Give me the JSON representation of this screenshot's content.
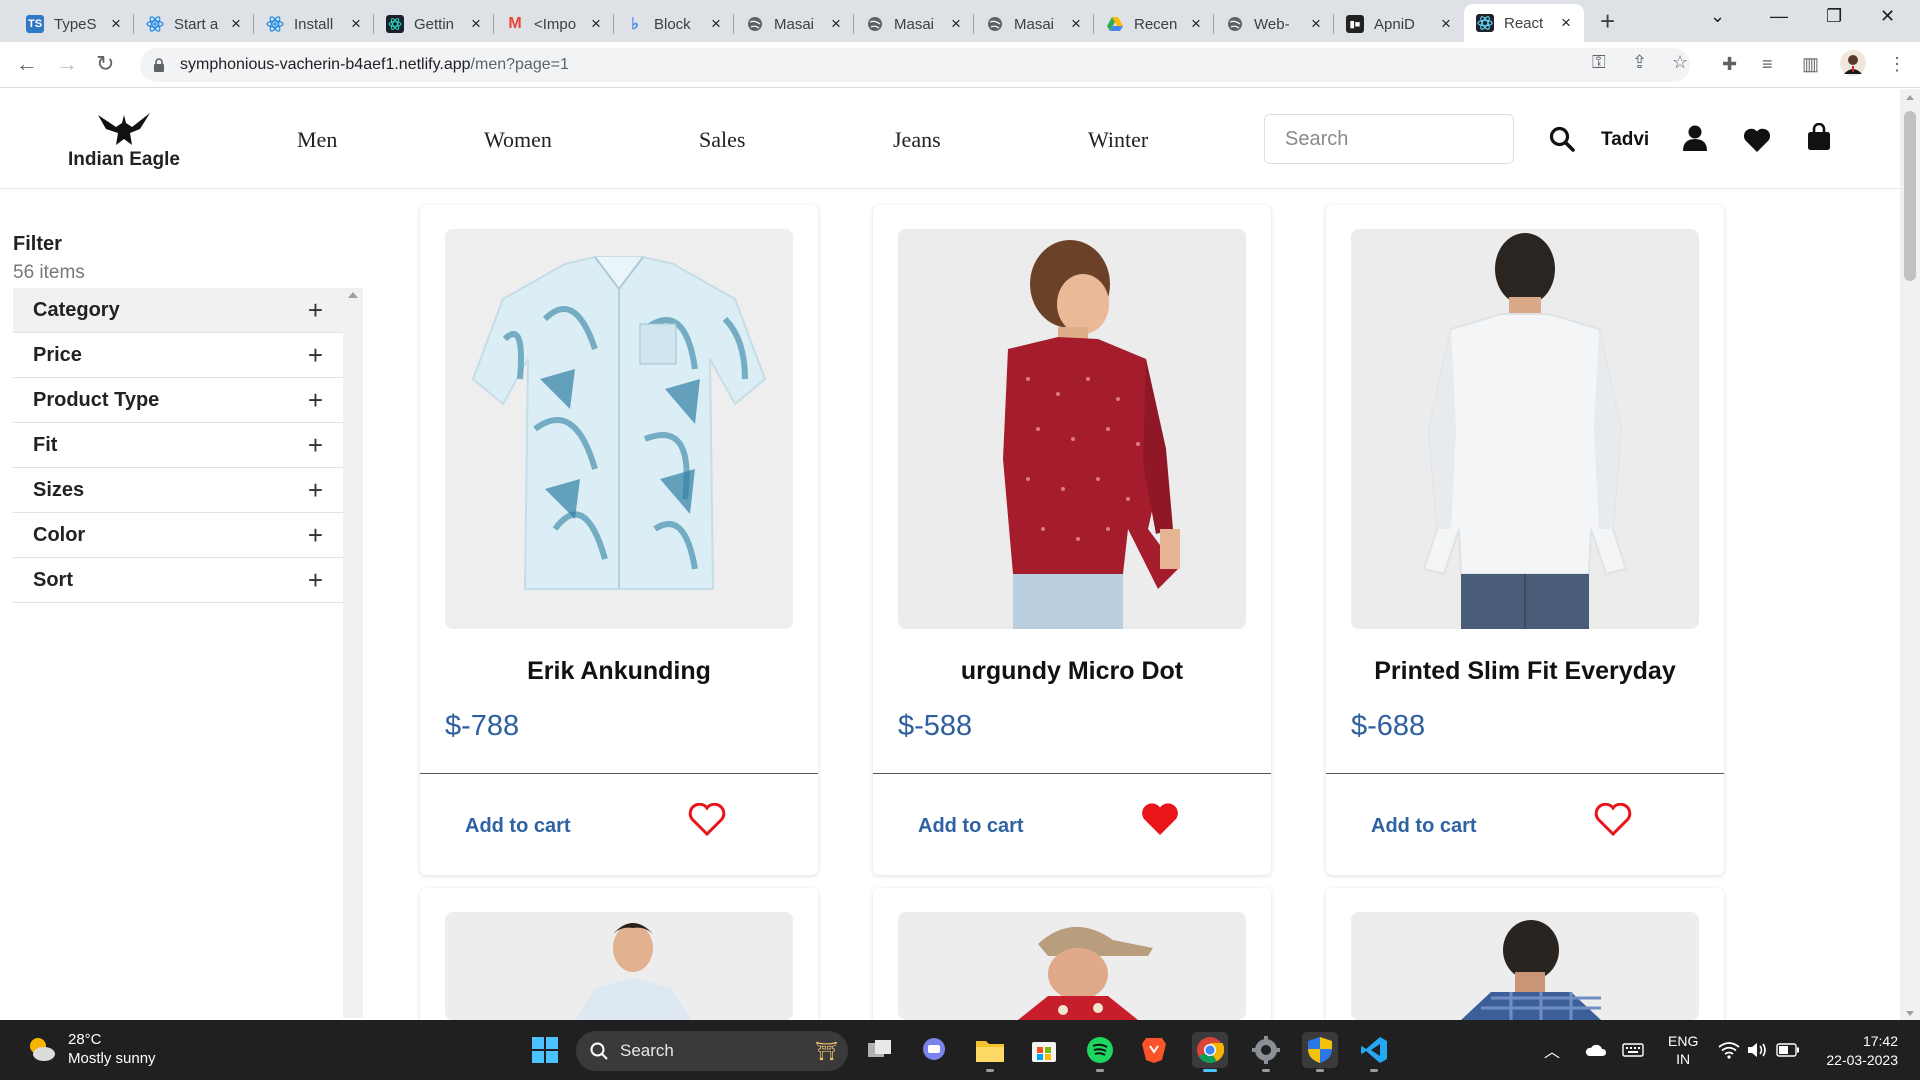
{
  "browser": {
    "tabs": [
      {
        "label": "TypeS",
        "icon": "typescript-icon",
        "color": "#3178c6"
      },
      {
        "label": "Start a",
        "icon": "react-icon",
        "color": "#1e88e5"
      },
      {
        "label": "Install",
        "icon": "react-icon",
        "color": "#1e88e5"
      },
      {
        "label": "Gettin",
        "icon": "chakra-icon",
        "color": "#2dd4bf"
      },
      {
        "label": "<Impo",
        "icon": "gmail-icon",
        "color": "#ea4335"
      },
      {
        "label": "Block",
        "icon": "block-icon",
        "color": "#4285f4"
      },
      {
        "label": "Masai",
        "icon": "globe-icon",
        "color": "#5f6368"
      },
      {
        "label": "Masai",
        "icon": "globe-icon",
        "color": "#5f6368"
      },
      {
        "label": "Masai",
        "icon": "globe-icon",
        "color": "#5f6368"
      },
      {
        "label": "Recen",
        "icon": "drive-icon",
        "color": "#34a853"
      },
      {
        "label": "Web-",
        "icon": "globe-icon",
        "color": "#5f6368"
      },
      {
        "label": "ApniD",
        "icon": "apni-icon",
        "color": "#222222"
      },
      {
        "label": "React",
        "icon": "react-icon",
        "color": "#1e88e5"
      }
    ],
    "active_tab_index": 12,
    "url_host": "symphonious-vacherin-b4aef1.netlify.app",
    "url_path": "/men?page=1"
  },
  "site": {
    "brand": "Indian Eagle",
    "nav": [
      "Men",
      "Women",
      "Sales",
      "Jeans",
      "Winter"
    ],
    "search_placeholder": "Search",
    "user_name": "Tadvi"
  },
  "filter": {
    "title": "Filter",
    "count": "56 items",
    "items": [
      "Category",
      "Price",
      "Product Type",
      "Fit",
      "Sizes",
      "Color",
      "Sort"
    ],
    "expand_symbol": "+"
  },
  "products": [
    {
      "name": "Erik Ankunding",
      "price": "$-788",
      "cart_label": "Add to cart",
      "favorited": false,
      "image": "printed-shirt-image"
    },
    {
      "name": "urgundy Micro Dot",
      "price": "$-588",
      "cart_label": "Add to cart",
      "favorited": true,
      "image": "burgundy-shirt-model-image"
    },
    {
      "name": "Printed Slim Fit Everyday",
      "price": "$-688",
      "cart_label": "Add to cart",
      "favorited": false,
      "image": "white-shirt-model-image"
    },
    {
      "image": "model-light-shirt-image"
    },
    {
      "image": "model-cap-image"
    },
    {
      "image": "model-plaid-image"
    }
  ],
  "colors": {
    "price": "#2f5f9e",
    "cart_link": "#2f62a3",
    "heart": "#e8151b"
  },
  "taskbar": {
    "temperature": "28°C",
    "weather": "Mostly sunny",
    "search_label": "Search",
    "language": "ENG",
    "region": "IN",
    "time": "17:42",
    "date": "22-03-2023"
  }
}
